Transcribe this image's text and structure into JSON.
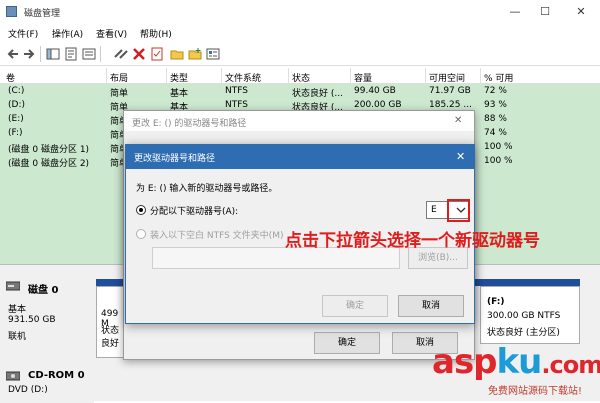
{
  "window": {
    "title": "磁盘管理",
    "minimize": "—",
    "maximize": "☐",
    "close": "✕"
  },
  "menu": [
    "文件(F)",
    "操作(A)",
    "查看(V)",
    "帮助(H)"
  ],
  "columns": [
    "卷",
    "布局",
    "类型",
    "文件系统",
    "状态",
    "容量",
    "可用空间",
    "% 可用"
  ],
  "volumes": [
    {
      "vol": "(C:)",
      "layout": "简单",
      "type": "基本",
      "fs": "NTFS",
      "status": "状态良好 (...",
      "cap": "99.40 GB",
      "free": "71.97 GB",
      "pct": "72 %"
    },
    {
      "vol": "(D:)",
      "layout": "简单",
      "type": "基本",
      "fs": "NTFS",
      "status": "状态良好 (...",
      "cap": "200.00 GB",
      "free": "185.25 ...",
      "pct": "93 %"
    },
    {
      "vol": "(E:)",
      "layout": "简单",
      "type": "基本",
      "fs": "",
      "status": "",
      "cap": "",
      "free": "",
      "pct": "88 %"
    },
    {
      "vol": "(F:)",
      "layout": "简单",
      "type": "",
      "fs": "",
      "status": "",
      "cap": "",
      "free": "",
      "pct": "74 %"
    },
    {
      "vol": "(磁盘 0 磁盘分区 1)",
      "layout": "简单",
      "type": "",
      "fs": "",
      "status": "",
      "cap": "",
      "free": "",
      "pct": "100 %"
    },
    {
      "vol": "(磁盘 0 磁盘分区 2)",
      "layout": "简单",
      "type": "",
      "fs": "",
      "status": "",
      "cap": "",
      "free": "",
      "pct": "100 %"
    }
  ],
  "disk0": {
    "name": "磁盘 0",
    "kind": "基本",
    "size": "931.50 GB",
    "state": "联机",
    "part_left_size": "499 M",
    "part_left_state": "状态良好",
    "part_f_name": "(F:)",
    "part_f_size": "300.00 GB NTFS",
    "part_f_state": "状态良好 (主分区)"
  },
  "cdrom": {
    "name": "CD-ROM 0",
    "kind": "DVD (D:)"
  },
  "outer_dialog": {
    "title": "更改 E: () 的驱动器号和路径",
    "close": "✕",
    "ok": "确定",
    "cancel": "取消"
  },
  "inner_dialog": {
    "title": "更改驱动器号和路径",
    "close": "✕",
    "prompt": "为 E: () 输入新的驱动器号或路径。",
    "option1": "分配以下驱动器号(A):",
    "option2": "装入以下空白 NTFS 文件夹中(M)",
    "drive_value": "E",
    "browse": "浏览(B)...",
    "ok": "确定",
    "cancel": "取消"
  },
  "annotation": "点击下拉箭头选择一个新驱动器号",
  "watermark": {
    "part1": "asp",
    "part2": "ku",
    "part3": ".com",
    "sub": "免费网站源码下载站!"
  },
  "colors": {
    "volume_bg": "#cce8cf",
    "dialog_title": "#2f6db3",
    "annotation": "#e11c1c"
  }
}
